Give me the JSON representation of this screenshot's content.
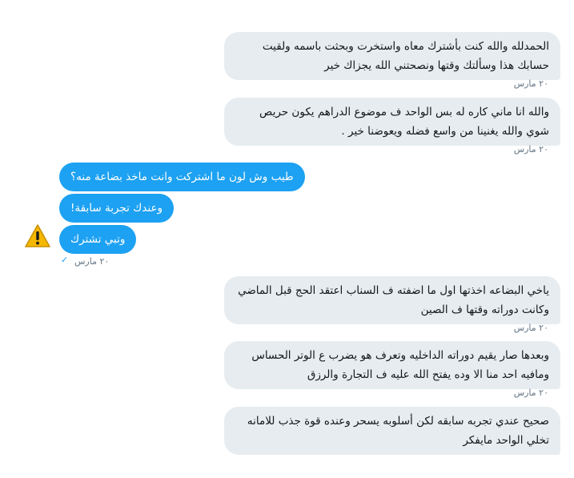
{
  "conversation": {
    "messages": [
      {
        "side": "received",
        "text": "الحمدلله والله كنت بأشترك معاه واستخرت وبحثت باسمه ولقيت حسابك هذا وسألتك وقتها ونصحتني الله يجزاك خير",
        "time": "٢٠ مارس"
      },
      {
        "side": "received",
        "text": "والله انا ماني كاره له بس الواحد ف موضوع الدراهم يكون حريص شوي والله يغنينا من واسع فضله ويعوضنا خير .",
        "time": "٢٠ مارس"
      },
      {
        "side": "sent",
        "text": "طيب وش لون ما اشتركت وانت ماخذ بضاعة منه؟"
      },
      {
        "side": "sent",
        "text": "وعندك تجربة سابقة!"
      },
      {
        "side": "sent",
        "text": "وتبي تشترك",
        "time": "٢٠ مارس"
      },
      {
        "side": "received",
        "text": "ياخي البضاعه اخذتها اول ما اضفته ف السناب اعتقد الحج قبل الماضي وكانت دوراته وقتها ف الصين",
        "time": "٢٠ مارس"
      },
      {
        "side": "received",
        "text": "وبعدها صار يقيم دوراته الداخليه وتعرف هو يضرب ع الوتر الحساس ومافيه احد منا الا وده يفتح الله عليه ف التجارة والرزق",
        "time": "٢٠ مارس"
      },
      {
        "side": "received",
        "text": "صحيح عندي تجربه سابقه لكن أسلوبه يسحر وعنده قوة جذب للامانه تخلي الواحد مايفكر"
      }
    ]
  },
  "icons": {
    "read_receipt": "checkmark-icon",
    "failed_message": "warning-icon"
  },
  "colors": {
    "sent_bubble": "#1da1f2",
    "received_bubble": "#e6ecf0",
    "timestamp": "#657786",
    "warning": "#f5b800"
  }
}
